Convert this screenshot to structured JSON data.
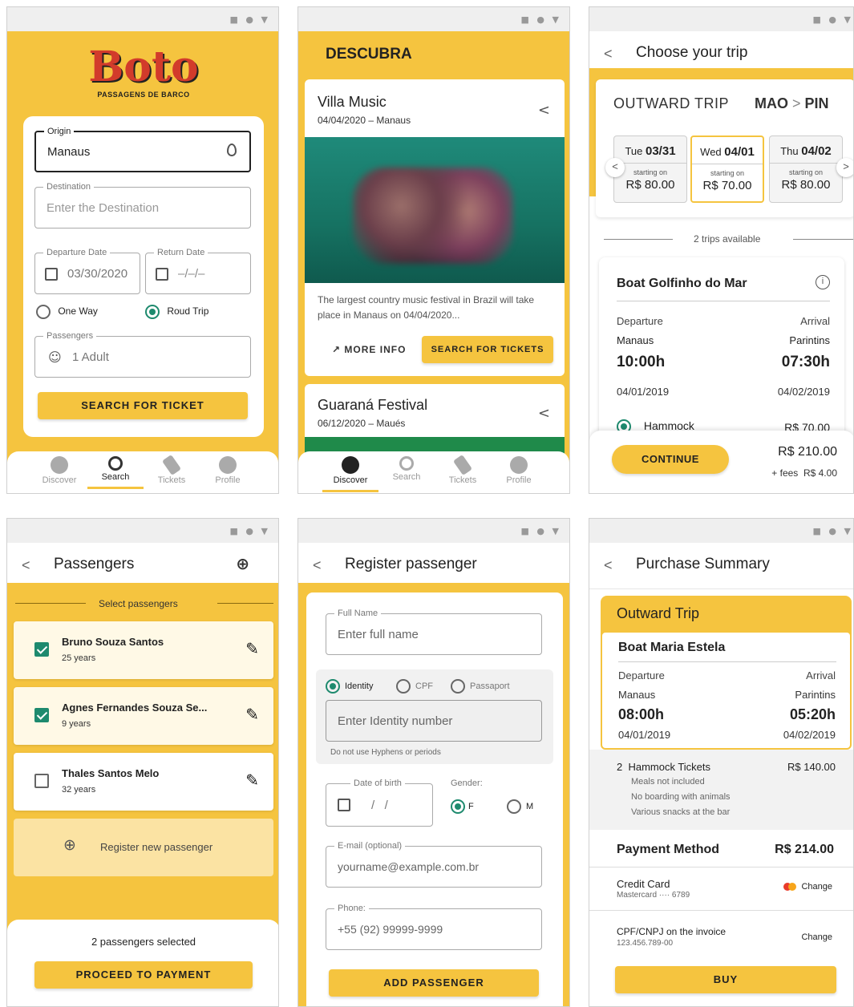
{
  "status_icons": "■ ● ▼",
  "s1": {
    "logo": "Boto",
    "tagline": "PASSAGENS DE BARCO",
    "origin_label": "Origin",
    "origin_value": "Manaus",
    "dest_label": "Destination",
    "dest_placeholder": "Enter the Destination",
    "dep_label": "Departure Date",
    "dep_value": "03/30/2020",
    "ret_label": "Return Date",
    "ret_value": "–/–/–",
    "one_way": "One Way",
    "round_trip": "Roud Trip",
    "pass_label": "Passengers",
    "pass_value": "1 Adult",
    "search_btn": "SEARCH FOR TICKET",
    "nav": [
      "Discover",
      "Search",
      "Tickets",
      "Profile"
    ]
  },
  "s2": {
    "title": "DESCUBRA",
    "event1_title": "Villa Music",
    "event1_sub": "04/04/2020 – Manaus",
    "event1_desc": "The largest country music festival in Brazil will take place in Manaus on 04/04/2020...",
    "more_info": "MORE INFO",
    "search_tickets": "SEARCH FOR TICKETS",
    "event2_title": "Guaraná Festival",
    "event2_sub": "06/12/2020 – Maués",
    "nav": [
      "Discover",
      "Search",
      "Tickets",
      "Profile"
    ]
  },
  "s3": {
    "title": "Choose your trip",
    "outward": "OUTWARD TRIP",
    "from": "MAO",
    "to": "PIN",
    "dates": [
      {
        "day": "Tue",
        "date": "03/31",
        "starting": "starting on",
        "price": "R$ 80.00"
      },
      {
        "day": "Wed",
        "date": "04/01",
        "starting": "starting on",
        "price": "R$ 70.00"
      },
      {
        "day": "Thu",
        "date": "04/02",
        "starting": "starting on",
        "price": "R$ 80.00"
      }
    ],
    "trips_available": "2 trips available",
    "boat": "Boat Golfinho do Mar",
    "departure": "Departure",
    "arrival": "Arrival",
    "dep_city": "Manaus",
    "arr_city": "Parintins",
    "dep_time": "10:00h",
    "arr_time": "07:30h",
    "dep_date": "04/01/2019",
    "arr_date": "04/02/2019",
    "hammock": "Hammock",
    "hammock_price": "R$ 70.00",
    "continue": "CONTINUE",
    "total": "R$ 210.00",
    "fees": "+ fees  R$ 4.00"
  },
  "s4": {
    "title": "Passengers",
    "select": "Select passengers",
    "passengers": [
      {
        "name": "Bruno Souza Santos",
        "age": "25 years"
      },
      {
        "name": "Agnes Fernandes Souza Se...",
        "age": "9 years"
      },
      {
        "name": "Thales Santos Melo",
        "age": "32 years"
      }
    ],
    "register_new": "Register new passenger",
    "selected": "2 passengers selected",
    "proceed": "PROCEED TO PAYMENT"
  },
  "s5": {
    "title": "Register passenger",
    "full_name_label": "Full Name",
    "full_name_ph": "Enter full name",
    "doc_identity": "Identity",
    "doc_cpf": "CPF",
    "doc_passport": "Passaport",
    "identity_ph": "Enter Identity number",
    "hint": "Do not use Hyphens or periods",
    "dob_label": "Date of birth",
    "dob_value": "/   /",
    "gender_label": "Gender:",
    "gender_f": "F",
    "gender_m": "M",
    "email_label": "E-mail (optional)",
    "email_ph": "yourname@example.com.br",
    "phone_label": "Phone:",
    "phone_ph": "+55 (92) 99999-9999",
    "add": "ADD PASSENGER"
  },
  "s6": {
    "title": "Purchase Summary",
    "outward": "Outward Trip",
    "boat": "Boat Maria Estela",
    "departure": "Departure",
    "arrival": "Arrival",
    "dep_city": "Manaus",
    "arr_city": "Parintins",
    "dep_time": "08:00h",
    "arr_time": "05:20h",
    "dep_date": "04/01/2019",
    "arr_date": "04/02/2019",
    "tickets": "2  Hammock Tickets",
    "tickets_price": "R$ 140.00",
    "notes": [
      "Meals not included",
      "No boarding with animals",
      "Various snacks at the bar"
    ],
    "payment_method": "Payment Method",
    "payment_total": "R$ 214.00",
    "card": "Credit Card",
    "card_sub": "Mastercard ···· 6789",
    "change": "Change",
    "cpf_label": "CPF/CNPJ on the invoice",
    "cpf_value": "123.456.789-00",
    "buy": "BUY"
  }
}
